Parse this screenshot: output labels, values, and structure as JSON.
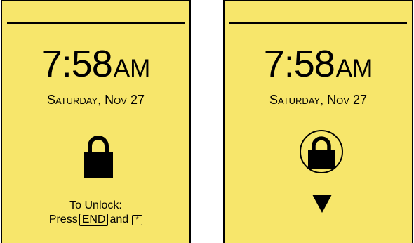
{
  "colors": {
    "screen_background": "#f7e66b",
    "ink": "#000000"
  },
  "screens": [
    {
      "time": {
        "digits": "7:58",
        "ampm": "AM"
      },
      "date": "Saturday, Nov 27",
      "icon": "lock-icon",
      "instructions": {
        "line1": "To Unlock:",
        "press": "Press",
        "key_end": "END",
        "and": "and",
        "key_star": "*"
      }
    },
    {
      "time": {
        "digits": "7:58",
        "ampm": "AM"
      },
      "date": "Saturday, Nov 27",
      "icon": "lock-icon",
      "hint_icon": "down-arrow-icon"
    }
  ]
}
